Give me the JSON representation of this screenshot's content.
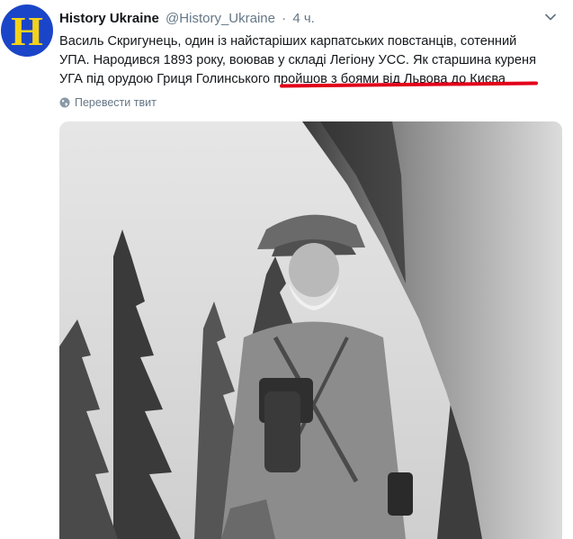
{
  "author": {
    "avatar_letter": "H",
    "name": "History Ukraine",
    "handle": "@History_Ukraine",
    "separator": "·",
    "time": "4 ч."
  },
  "tweet": {
    "lines": [
      "Василь Скригунець, один із найстаріших карпатських повстанців, сотенний",
      "УПА. Народився 1893 року, воював у складі Легіону УСС. Як старшина  куреня",
      "УГА під орудою Гриця Голинського пройшов з боями від Львова до Києва"
    ]
  },
  "translate_label": "Перевести твит",
  "icons": {
    "menu": "chevron-down-icon",
    "translate": "globe-icon"
  },
  "colors": {
    "avatar_bg": "#1b45c8",
    "avatar_letter": "#f4d21a",
    "underline": "#e2001a",
    "meta": "#657786"
  }
}
